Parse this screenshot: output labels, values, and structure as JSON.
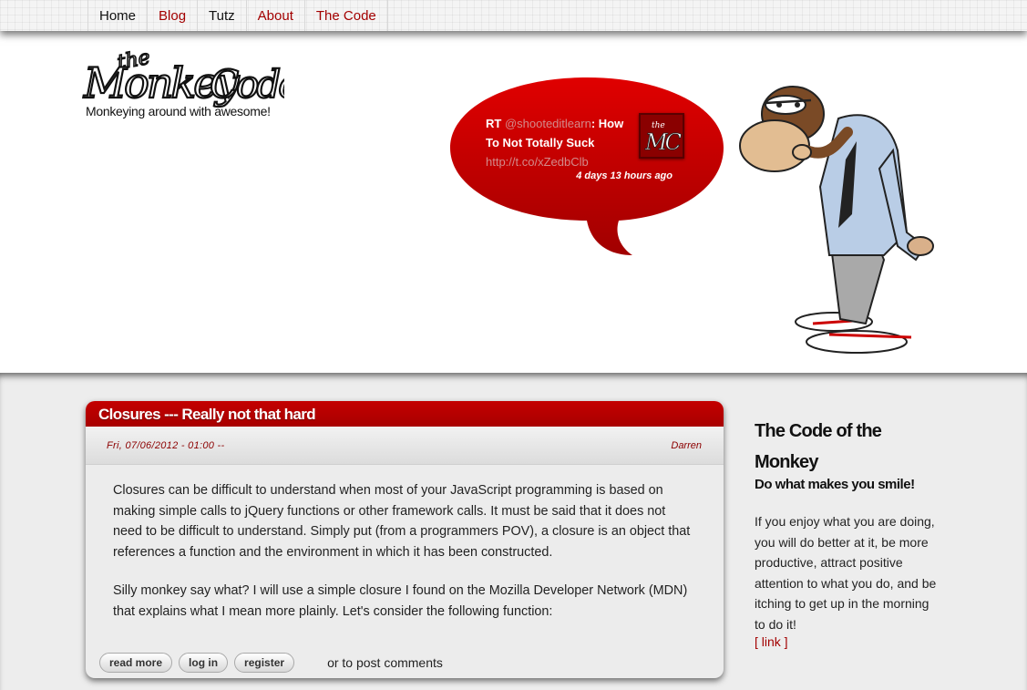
{
  "nav": {
    "items": [
      {
        "label": "Home",
        "color": "#111111"
      },
      {
        "label": "Blog",
        "color": "#a30000"
      },
      {
        "label": "Tutz",
        "color": "#111111"
      },
      {
        "label": "About",
        "color": "#a30000"
      },
      {
        "label": "The Code",
        "color": "#a30000"
      }
    ]
  },
  "header": {
    "logo_text": "the Monkey Code",
    "tagline": "Monkeying around with awesome!"
  },
  "tweet": {
    "prefix": "RT ",
    "handle": "@shooteditlearn",
    "text": ": How To Not Totally Suck",
    "url": "http://t.co/xZedbClb",
    "time": "4 days 13 hours ago",
    "avatar_text": "MC"
  },
  "post": {
    "title": "Closures --- Really not that hard",
    "date": "Fri, 07/06/2012 - 01:00 --",
    "author": "Darren",
    "paragraphs": [
      "Closures can be difficult to understand when most of your JavaScript programming is based on making simple calls to jQuery functions or other framework calls. It must be said that it does not need to be difficult to understand. Simply put (from a programmers POV), a closure is an object that references a function and the environment in which it has been constructed.",
      "Silly monkey say what? I will use a simple closure I found on the Mozilla Developer Network (MDN) that explains what I mean more plainly. Let's consider the following function:"
    ],
    "buttons": {
      "read_more": "read more",
      "log_in": "log in",
      "register": "register"
    },
    "comment_text": "or to post comments"
  },
  "sidebar": {
    "title": "The Code of the Monkey",
    "subtitle": "Do what makes you smile!",
    "body": "If you enjoy what you are doing, you will do better at it, be more productive, attract positive attention to what you do, and be itching to get up in the morning to do it!",
    "link": "[ link ]"
  },
  "colors": {
    "accent": "#a30000",
    "bubble": "#c80000",
    "band": "#ededed"
  }
}
